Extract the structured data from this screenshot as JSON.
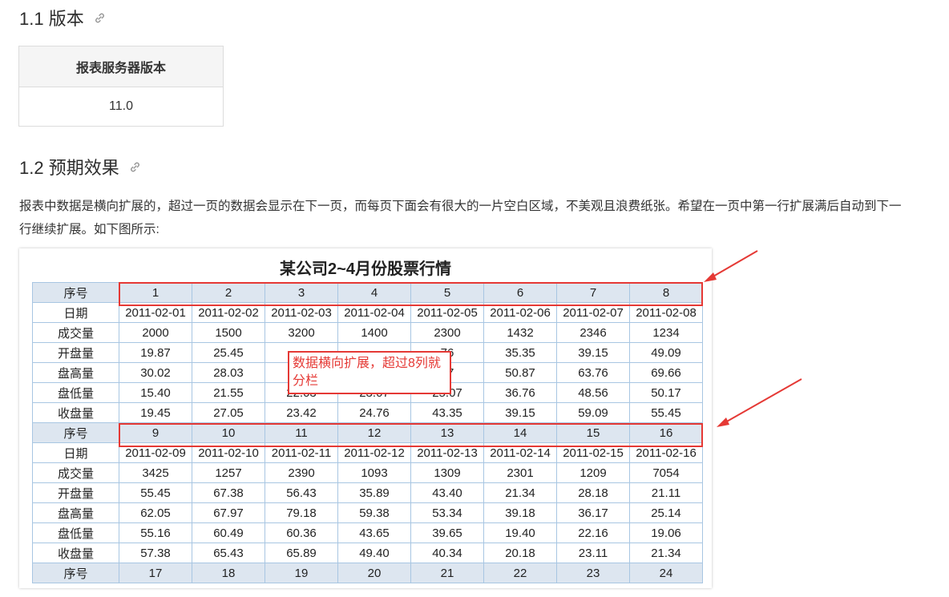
{
  "sections": [
    {
      "title": "1.1 版本"
    },
    {
      "title": "1.2 预期效果"
    }
  ],
  "version_table": {
    "header": "报表服务器版本",
    "value": "11.0"
  },
  "paragraph": "报表中数据是横向扩展的，超过一页的数据会显示在下一页，而每页下面会有很大的一片空白区域，不美观且浪费纸张。希望在一页中第一行扩展满后自动到下一行继续扩展。如下图所示:",
  "figure": {
    "title": "某公司2~4月份股票行情",
    "note": "数据横向扩展，超过8列就分栏",
    "row_labels": {
      "seq": "序号",
      "date": "日期",
      "volume": "成交量",
      "open": "开盘量",
      "high": "盘高量",
      "low": "盘低量",
      "close": "收盘量"
    },
    "blocks": [
      {
        "seq": [
          "1",
          "2",
          "3",
          "4",
          "5",
          "6",
          "7",
          "8"
        ],
        "date": [
          "2011-02-01",
          "2011-02-02",
          "2011-02-03",
          "2011-02-04",
          "2011-02-05",
          "2011-02-06",
          "2011-02-07",
          "2011-02-08"
        ],
        "volume": [
          "2000",
          "1500",
          "3200",
          "1400",
          "2300",
          "1432",
          "2346",
          "1234"
        ],
        "open": [
          "19.87",
          "25.45",
          "",
          "",
          "76",
          "35.35",
          "39.15",
          "49.09"
        ],
        "high": [
          "30.02",
          "28.03",
          "",
          "",
          "87",
          "50.87",
          "63.76",
          "69.66"
        ],
        "low": [
          "15.40",
          "21.55",
          "22.03",
          "23.07",
          "25.07",
          "36.76",
          "48.56",
          "50.17"
        ],
        "close": [
          "19.45",
          "27.05",
          "23.42",
          "24.76",
          "43.35",
          "39.15",
          "59.09",
          "55.45"
        ]
      },
      {
        "seq": [
          "9",
          "10",
          "11",
          "12",
          "13",
          "14",
          "15",
          "16"
        ],
        "date": [
          "2011-02-09",
          "2011-02-10",
          "2011-02-11",
          "2011-02-12",
          "2011-02-13",
          "2011-02-14",
          "2011-02-15",
          "2011-02-16"
        ],
        "volume": [
          "3425",
          "1257",
          "2390",
          "1093",
          "1309",
          "2301",
          "1209",
          "7054"
        ],
        "open": [
          "55.45",
          "67.38",
          "56.43",
          "35.89",
          "43.40",
          "21.34",
          "28.18",
          "21.11"
        ],
        "high": [
          "62.05",
          "67.97",
          "79.18",
          "59.38",
          "53.34",
          "39.18",
          "36.17",
          "25.14"
        ],
        "low": [
          "55.16",
          "60.49",
          "60.36",
          "43.65",
          "39.65",
          "19.40",
          "22.16",
          "19.06"
        ],
        "close": [
          "57.38",
          "65.43",
          "65.89",
          "49.40",
          "40.34",
          "20.18",
          "23.11",
          "21.34"
        ]
      },
      {
        "seq": [
          "17",
          "18",
          "19",
          "20",
          "21",
          "22",
          "23",
          "24"
        ]
      }
    ]
  }
}
